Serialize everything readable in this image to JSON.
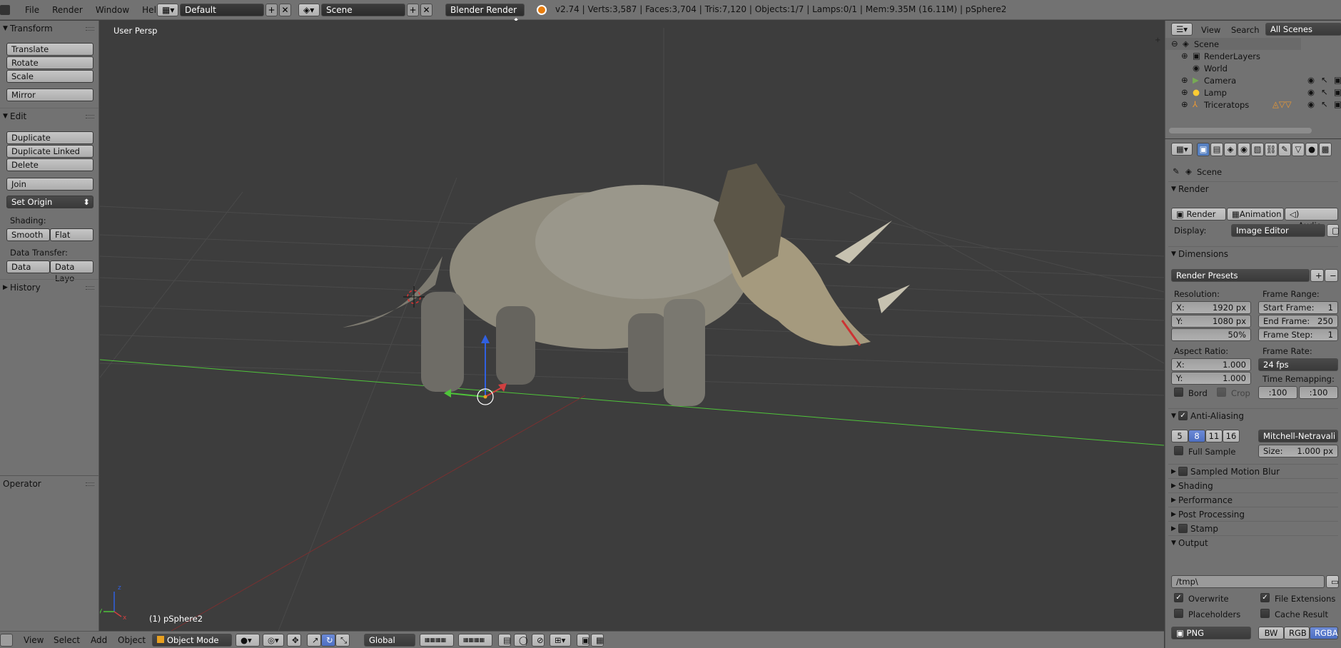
{
  "topbar": {
    "menus": [
      "File",
      "Render",
      "Window",
      "Help"
    ],
    "screen_layout": "Default",
    "scene": "Scene",
    "engine": "Blender Render",
    "stats": "v2.74 | Verts:3,587 | Faces:3,704 | Tris:7,120 | Objects:1/7 | Lamps:0/1 | Mem:9.35M (16.11M) | pSphere2"
  },
  "toolshelf": {
    "transform_title": "Transform",
    "translate": "Translate",
    "rotate": "Rotate",
    "scale": "Scale",
    "mirror": "Mirror",
    "edit_title": "Edit",
    "duplicate": "Duplicate",
    "duplicate_linked": "Duplicate Linked",
    "delete": "Delete",
    "join": "Join",
    "set_origin": "Set Origin",
    "shading_label": "Shading:",
    "smooth": "Smooth",
    "flat": "Flat",
    "data_transfer_label": "Data Transfer:",
    "data": "Data",
    "data_layo": "Data Layo",
    "history_title": "History",
    "operator_title": "Operator"
  },
  "viewport": {
    "view_label": "User Persp",
    "object_label": "(1) pSphere2",
    "axis_x": "x",
    "axis_y": "y",
    "axis_z": "z"
  },
  "view_header": {
    "view": "View",
    "select": "Select",
    "add": "Add",
    "object": "Object",
    "mode": "Object Mode",
    "orientation": "Global"
  },
  "outliner": {
    "view": "View",
    "search": "Search",
    "filter": "All Scenes",
    "items": [
      "Scene",
      "RenderLayers",
      "World",
      "Camera",
      "Lamp",
      "Triceratops"
    ]
  },
  "properties": {
    "context": "Scene",
    "render_section": "Render",
    "render_btn": "Render",
    "animation_btn": "Animation",
    "audio_btn": "Audio",
    "display_label": "Display:",
    "display_value": "Image Editor",
    "dimensions_section": "Dimensions",
    "render_presets": "Render Presets",
    "resolution_label": "Resolution:",
    "res_x": "1920 px",
    "res_y": "1080 px",
    "res_pct": "50%",
    "frame_range_label": "Frame Range:",
    "start_frame": "Start Frame:",
    "start_frame_val": "1",
    "end_frame": "End Frame:",
    "end_frame_val": "250",
    "frame_step": "Frame Step:",
    "frame_step_val": "1",
    "aspect_label": "Aspect Ratio:",
    "aspect_x": "1.000",
    "aspect_y": "1.000",
    "frame_rate_label": "Frame Rate:",
    "frame_rate": "24 fps",
    "time_remap_label": "Time Remapping:",
    "remap_old": ":100",
    "remap_new": ":100",
    "bord": "Bord",
    "crop": "Crop",
    "aa_section": "Anti-Aliasing",
    "aa_samples": [
      "5",
      "8",
      "11",
      "16"
    ],
    "aa_filter": "Mitchell-Netravali",
    "full_sample": "Full Sample",
    "size_label": "Size:",
    "size_val": "1.000 px",
    "motion_blur": "Sampled Motion Blur",
    "shading": "Shading",
    "performance": "Performance",
    "post_processing": "Post Processing",
    "stamp": "Stamp",
    "output_section": "Output",
    "output_path": "/tmp\\",
    "overwrite": "Overwrite",
    "file_extensions": "File Extensions",
    "placeholders": "Placeholders",
    "cache_result": "Cache Result",
    "format": "PNG",
    "bw": "BW",
    "rgb": "RGB",
    "rgba": "RGBA"
  },
  "colors": {
    "accent_blue": "#5680c2",
    "x_axis": "#c84040",
    "y_axis": "#4fc43a",
    "z_axis": "#3060e0"
  }
}
